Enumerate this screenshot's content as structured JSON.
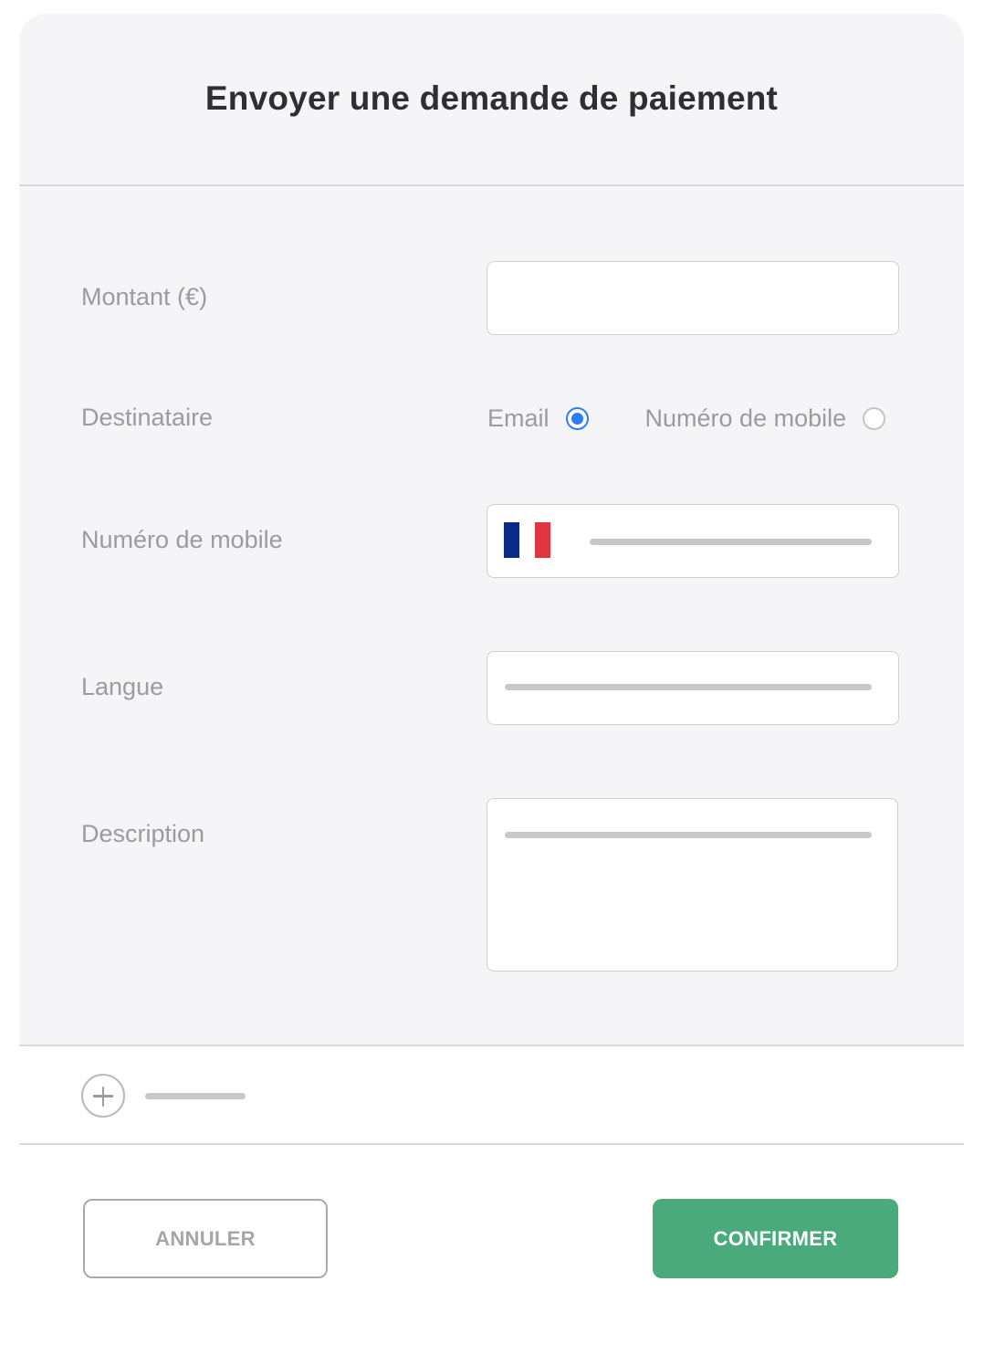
{
  "dialog": {
    "title": "Envoyer une demande de paiement"
  },
  "form": {
    "amount_label": "Montant (€)",
    "amount_value": "",
    "recipient_label": "Destinataire",
    "recipient_options": [
      {
        "label": "Email",
        "checked": true
      },
      {
        "label": "Numéro de mobile",
        "checked": false
      }
    ],
    "mobile_label": "Numéro de mobile",
    "mobile_flag": "france-flag-icon",
    "language_label": "Langue",
    "description_label": "Description"
  },
  "actions": {
    "add_icon": "plus-icon",
    "cancel_label": "ANNULER",
    "confirm_label": "CONFIRMER"
  },
  "colors": {
    "accent": "#2e7cf6",
    "confirm": "#4baa7c",
    "panel_bg": "#f5f5f7"
  }
}
